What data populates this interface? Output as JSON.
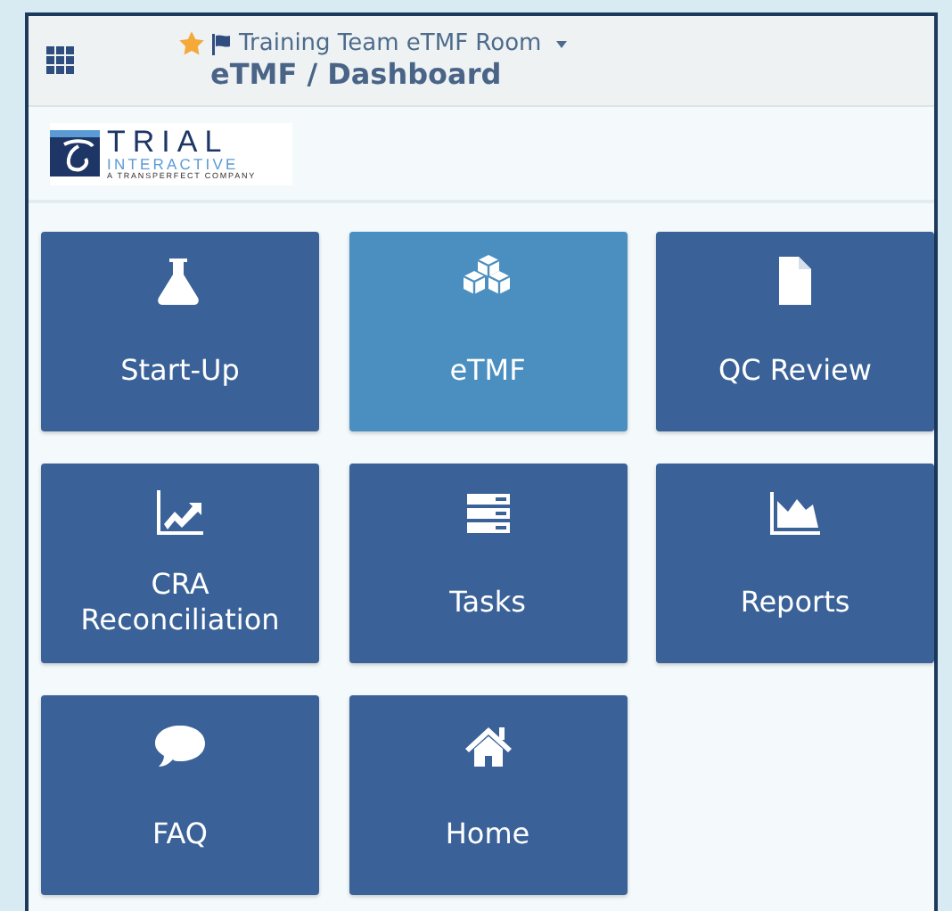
{
  "header": {
    "favorite": true,
    "room": "Training Team eTMF Room",
    "breadcrumb": "eTMF / Dashboard"
  },
  "logo": {
    "name": "TRIAL",
    "subtitle": "INTERACTIVE",
    "tagline": "A TRANSPERFECT COMPANY"
  },
  "tiles": [
    {
      "label": "Start-Up",
      "kind": "flask",
      "selected": false
    },
    {
      "label": "eTMF",
      "kind": "cubes",
      "selected": true
    },
    {
      "label": "QC Review",
      "kind": "document",
      "selected": false
    },
    {
      "label": "CRA Reconciliation",
      "kind": "trend",
      "selected": false
    },
    {
      "label": "Tasks",
      "kind": "tasks",
      "selected": false
    },
    {
      "label": "Reports",
      "kind": "area",
      "selected": false
    },
    {
      "label": "FAQ",
      "kind": "comment",
      "selected": false
    },
    {
      "label": "Home",
      "kind": "home",
      "selected": false
    }
  ]
}
